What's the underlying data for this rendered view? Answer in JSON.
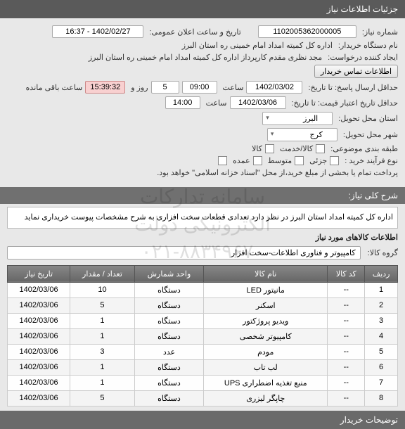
{
  "header": "جزئیات اطلاعات نیاز",
  "fields": {
    "req_no_label": "شماره نیاز:",
    "req_no": "1102005362000005",
    "announce_label": "تاریخ و ساعت اعلان عمومی:",
    "announce": "1402/02/27 - 16:37",
    "buyer_label": "نام دستگاه خریدار:",
    "buyer": "اداره کل کمیته امداد امام خمینی  ره  استان البرز",
    "creator_label": "ایجاد کننده درخواست:",
    "creator": "مجد نظری مقدم کارپرداز اداره کل کمیته امداد امام خمینی  ره  استان البرز",
    "contact_btn": "اطلاعات تماس خریدار",
    "deadline_send_label": "حداقل ارسال پاسخ: تا تاریخ:",
    "deadline_send_date": "1402/03/02",
    "time_label": "ساعت",
    "deadline_send_time": "09:00",
    "days_label": "روز و",
    "days": "5",
    "remain_time": "15:39:32",
    "remain_label": "ساعت باقی مانده",
    "valid_label": "حداقل تاریخ اعتبار قیمت: تا تاریخ:",
    "valid_date": "1402/03/06",
    "valid_time": "14:00",
    "province_label": "استان محل تحویل:",
    "province": "البرز",
    "city_label": "شهر محل تحویل:",
    "city": "کرج",
    "topic_class_label": "طبقه بندی موضوعی:",
    "service_cb": "کالا/خدمت",
    "goods_cb": "کالا",
    "process_label": "نوع فرآیند خرید :",
    "p1": "جزئی",
    "p2": "متوسط",
    "p3": "عمده",
    "payment_note": "پرداخت تمام یا بخشی از مبلغ خرید،از محل \"اسناد خزانه اسلامی\" خواهد بود."
  },
  "desc_header": "شرح کلی نیاز:",
  "desc_text": "اداره کل کمیته امداد استان البرز در نظر دارد تعدادی قطعات سخت افزاری به شرح مشخصات پیوست خریداری نماید",
  "items_header": "اطلاعات کالاهای مورد نیاز",
  "group_label": "گروه کالا:",
  "group_value": "کامپیوتر و فناوری اطلاعات-سخت افزار",
  "table": {
    "headers": [
      "ردیف",
      "کد کالا",
      "نام کالا",
      "واحد شمارش",
      "تعداد / مقدار",
      "تاریخ نیاز"
    ],
    "rows": [
      [
        "1",
        "--",
        "مانیتور LED",
        "دستگاه",
        "10",
        "1402/03/06"
      ],
      [
        "2",
        "--",
        "اسکنر",
        "دستگاه",
        "5",
        "1402/03/06"
      ],
      [
        "3",
        "--",
        "ویدیو پروژکتور",
        "دستگاه",
        "1",
        "1402/03/06"
      ],
      [
        "4",
        "--",
        "کامپیوتر شخصی",
        "دستگاه",
        "1",
        "1402/03/06"
      ],
      [
        "5",
        "--",
        "مودم",
        "عدد",
        "3",
        "1402/03/06"
      ],
      [
        "6",
        "--",
        "لب تاب",
        "دستگاه",
        "1",
        "1402/03/06"
      ],
      [
        "7",
        "--",
        "منبع تغذیه اضطراری UPS",
        "دستگاه",
        "1",
        "1402/03/06"
      ],
      [
        "8",
        "--",
        "چاپگر لیزری",
        "دستگاه",
        "5",
        "1402/03/06"
      ]
    ]
  },
  "footer": "توضیحات خریدار",
  "watermark": {
    "l1": "سامانه تدارکات الکترونیکی دولت",
    "l2": "۰۲۱-۸۸۳۴۹۶۷۰"
  }
}
